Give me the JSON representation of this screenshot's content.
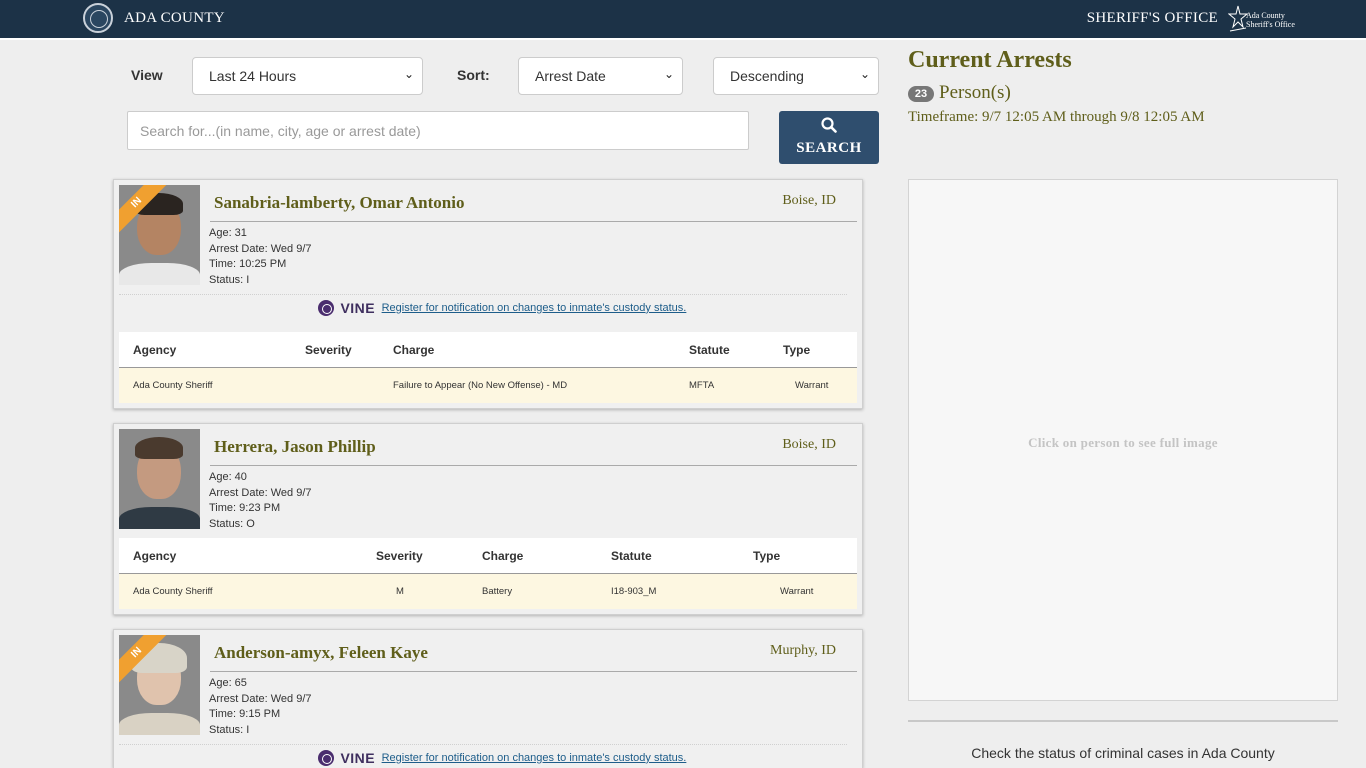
{
  "header": {
    "county_name": "ADA COUNTY",
    "office_name": "SHERIFF'S OFFICE",
    "logo_line1": "Ada County",
    "logo_line2": "Sheriff's Office"
  },
  "filters": {
    "view_label": "View",
    "view_value": "Last 24 Hours",
    "sort_label": "Sort:",
    "sort_value": "Arrest Date",
    "order_value": "Descending",
    "search_placeholder": "Search for...(in name, city, age or arrest date)",
    "search_button": "SEARCH"
  },
  "vine": {
    "word": "VINE",
    "link_text": " Register for notification on changes to inmate's custody status."
  },
  "arrests": [
    {
      "in_badge": "IN",
      "name": "Sanabria-lamberty, Omar Antonio",
      "city": "Boise, ID",
      "age": "Age: 31",
      "arrest_date": "Arrest Date: Wed 9/7",
      "time": "Time: 10:25 PM",
      "status": "Status: I",
      "charges_headers": [
        "Agency",
        "Severity",
        "Charge",
        "Statute",
        "Type"
      ],
      "charges": [
        {
          "agency": "Ada County Sheriff",
          "severity": "",
          "charge": "Failure to Appear (No New Offense) - MD",
          "statute": "MFTA",
          "type": "Warrant"
        }
      ]
    },
    {
      "in_badge": "",
      "name": "Herrera, Jason Phillip",
      "city": "Boise, ID",
      "age": "Age: 40",
      "arrest_date": "Arrest Date: Wed 9/7",
      "time": "Time: 9:23 PM",
      "status": "Status: O",
      "charges_headers": [
        "Agency",
        "Severity",
        "Charge",
        "Statute",
        "Type"
      ],
      "charges": [
        {
          "agency": "Ada County Sheriff",
          "severity": "M",
          "charge": "Battery",
          "statute": "I18-903_M",
          "type": "Warrant"
        }
      ]
    },
    {
      "in_badge": "IN",
      "name": "Anderson-amyx, Feleen Kaye",
      "city": "Murphy, ID",
      "age": "Age: 65",
      "arrest_date": "Arrest Date: Wed 9/7",
      "time": "Time: 9:15 PM",
      "status": "Status: I"
    }
  ],
  "summary": {
    "title": "Current Arrests",
    "count": "23",
    "persons_label": "Person(s)",
    "timeframe": "Timeframe: 9/7 12:05 AM through 9/8 12:05 AM",
    "viewer_hint": "Click on person to see full image",
    "case_status_text": "Check the status of criminal cases in Ada County"
  },
  "colors": {
    "header_bg": "#1c3247",
    "accent_olive": "#5f5e1a",
    "search_button": "#2f4e6e",
    "in_badge": "#f0a030",
    "charge_row": "#fdf7e1"
  }
}
